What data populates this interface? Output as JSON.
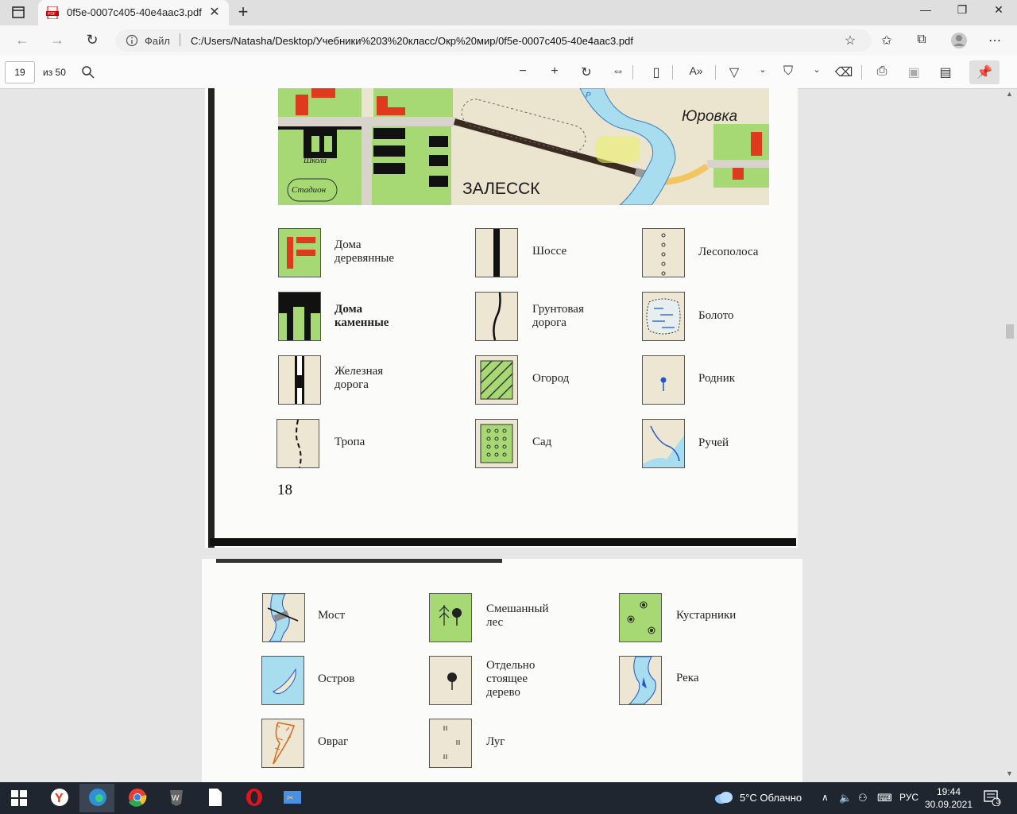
{
  "browser": {
    "tab_title": "0f5e-0007c405-40e4aac3.pdf",
    "tab_close": "✕",
    "new_tab": "+",
    "url_scheme_label": "Файл",
    "url": "C:/Users/Natasha/Desktop/Учебники%203%20класс/Окр%20мир/0f5e-0007c405-40e4aac3.pdf"
  },
  "pdf_toolbar": {
    "page_number": "19",
    "page_count": "из 50"
  },
  "map": {
    "town_left": "ЗАЛЕССК",
    "town_right": "Юровка",
    "school": "Школа",
    "stadium": "Стадион",
    "river_letter": "Р"
  },
  "page_number_printed": "18",
  "legend_page1": [
    {
      "label": "Дома\nдеревянные",
      "icon": "wooden-houses"
    },
    {
      "label": "Шоссе",
      "icon": "highway"
    },
    {
      "label": "Лесополоса",
      "icon": "forest-belt"
    },
    {
      "label": "Дома\nкаменные",
      "icon": "stone-houses"
    },
    {
      "label": "Грунтовая\nдорога",
      "icon": "dirt-road"
    },
    {
      "label": "Болото",
      "icon": "swamp"
    },
    {
      "label": "Железная\nдорога",
      "icon": "railway"
    },
    {
      "label": "Огород",
      "icon": "vegetable-garden"
    },
    {
      "label": "Родник",
      "icon": "spring"
    },
    {
      "label": "Тропа",
      "icon": "path"
    },
    {
      "label": "Сад",
      "icon": "orchard"
    },
    {
      "label": "Ручей",
      "icon": "stream"
    }
  ],
  "legend_page2": [
    {
      "label": "Мост",
      "icon": "bridge"
    },
    {
      "label": "Смешанный\nлес",
      "icon": "mixed-forest"
    },
    {
      "label": "Кустарники",
      "icon": "bushes"
    },
    {
      "label": "Остров",
      "icon": "island"
    },
    {
      "label": "Отдельно\nстоящее\nдерево",
      "icon": "single-tree"
    },
    {
      "label": "Река",
      "icon": "river"
    },
    {
      "label": "Овраг",
      "icon": "ravine"
    },
    {
      "label": "Луг",
      "icon": "meadow"
    }
  ],
  "taskbar": {
    "weather": "5°C  Облачно",
    "language": "РУС",
    "time": "19:44",
    "date": "30.09.2021",
    "notifications": "3"
  },
  "colors": {
    "map_green": "#a6d873",
    "house_red": "#e03a1e",
    "water_blue": "#a8dcef",
    "road_yellow": "#f3c560"
  }
}
